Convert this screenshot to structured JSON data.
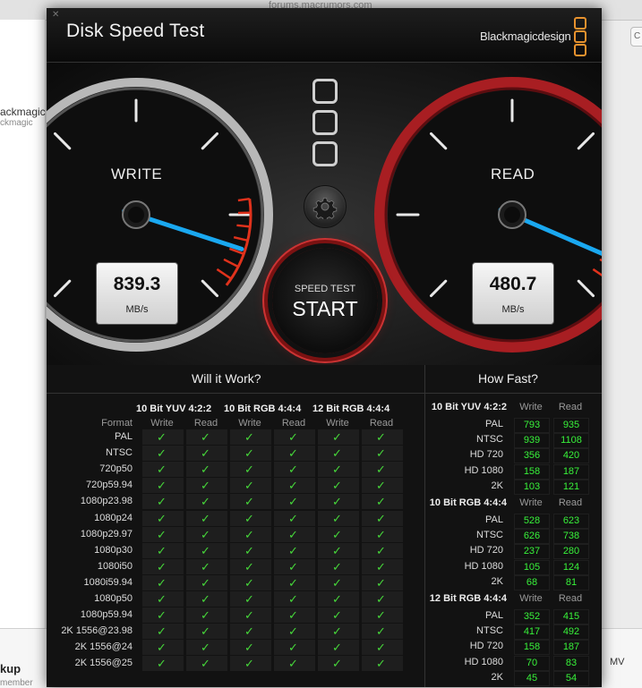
{
  "background": {
    "url_text": "forums.macrumors.com",
    "left_text_1": "ackmagic",
    "left_text_2": "ckmagic",
    "right_btn": "C",
    "bottom_left_1": "kup",
    "bottom_left_2": "member",
    "bottom_right": "MV"
  },
  "window": {
    "close_glyph": "✕",
    "title": "Disk Speed Test",
    "brand": "Blackmagicdesign"
  },
  "gauges": {
    "write": {
      "label": "WRITE",
      "value": "839.3",
      "unit": "MB/s",
      "level": 0.9
    },
    "read": {
      "label": "READ",
      "value": "480.7",
      "unit": "MB/s",
      "level": 0.92
    }
  },
  "start_button": {
    "top_label": "SPEED TEST",
    "main_label": "START"
  },
  "will_it_work": {
    "title": "Will it Work?",
    "format_header": "Format",
    "groups": [
      "10 Bit YUV 4:2:2",
      "10 Bit RGB 4:4:4",
      "12 Bit RGB 4:4:4"
    ],
    "sub_headers": [
      "Write",
      "Read",
      "Write",
      "Read",
      "Write",
      "Read"
    ],
    "check_glyph": "✓",
    "rows": [
      "PAL",
      "NTSC",
      "720p50",
      "720p59.94",
      "1080p23.98",
      "1080p24",
      "1080p29.97",
      "1080p30",
      "1080i50",
      "1080i59.94",
      "1080p50",
      "1080p59.94",
      "2K 1556@23.98",
      "2K 1556@24",
      "2K 1556@25"
    ]
  },
  "how_fast": {
    "title": "How Fast?",
    "sub_write": "Write",
    "sub_read": "Read",
    "groups": [
      {
        "name": "10 Bit YUV 4:2:2",
        "rows": [
          {
            "label": "PAL",
            "write": "793",
            "read": "935"
          },
          {
            "label": "NTSC",
            "write": "939",
            "read": "1108"
          },
          {
            "label": "HD 720",
            "write": "356",
            "read": "420"
          },
          {
            "label": "HD 1080",
            "write": "158",
            "read": "187"
          },
          {
            "label": "2K",
            "write": "103",
            "read": "121"
          }
        ]
      },
      {
        "name": "10 Bit RGB 4:4:4",
        "rows": [
          {
            "label": "PAL",
            "write": "528",
            "read": "623"
          },
          {
            "label": "NTSC",
            "write": "626",
            "read": "738"
          },
          {
            "label": "HD 720",
            "write": "237",
            "read": "280"
          },
          {
            "label": "HD 1080",
            "write": "105",
            "read": "124"
          },
          {
            "label": "2K",
            "write": "68",
            "read": "81"
          }
        ]
      },
      {
        "name": "12 Bit RGB 4:4:4",
        "rows": [
          {
            "label": "PAL",
            "write": "352",
            "read": "415"
          },
          {
            "label": "NTSC",
            "write": "417",
            "read": "492"
          },
          {
            "label": "HD 720",
            "write": "158",
            "read": "187"
          },
          {
            "label": "HD 1080",
            "write": "70",
            "read": "83"
          },
          {
            "label": "2K",
            "write": "45",
            "read": "54"
          }
        ]
      }
    ]
  },
  "colors": {
    "accent_orange": "#e8922e",
    "needle_blue": "#1aa8f0",
    "ok_green": "#46d63a",
    "value_green": "#38f23a",
    "read_ring_red": "#a81e22",
    "redline": "#e0321c"
  }
}
